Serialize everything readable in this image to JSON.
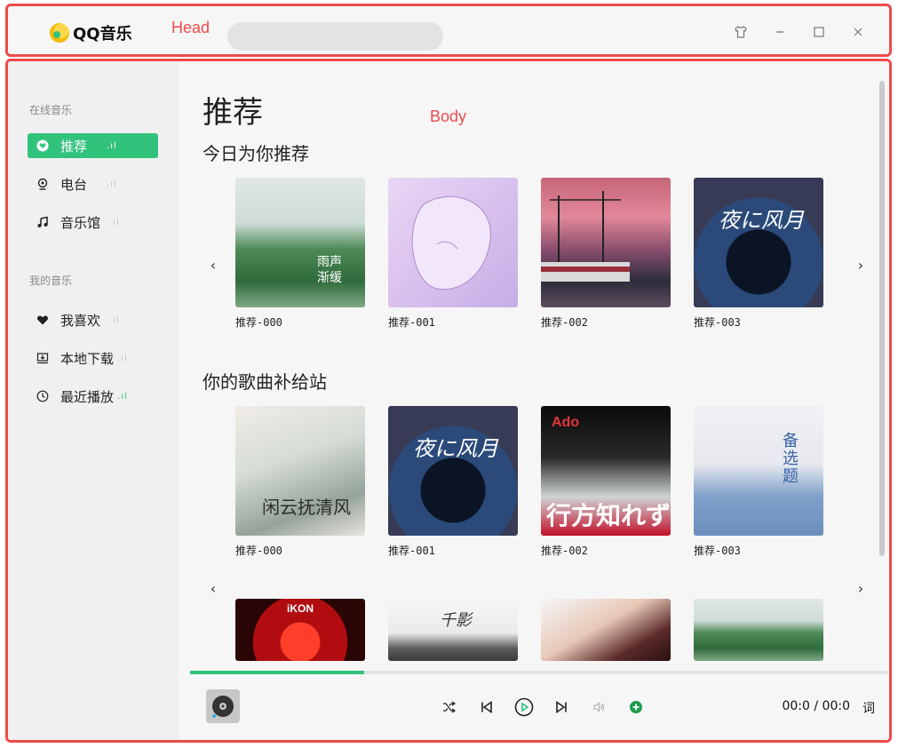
{
  "overlay": {
    "head_tag": "Head",
    "body_tag": "Body"
  },
  "header": {
    "app_name": "QQ音乐",
    "search_placeholder": ""
  },
  "sidebar": {
    "online_title": "在线音乐",
    "mine_title": "我的音乐",
    "items": [
      {
        "label": "推荐",
        "icon": "heart-disc-icon"
      },
      {
        "label": "电台",
        "icon": "radio-icon"
      },
      {
        "label": "音乐馆",
        "icon": "music-note-icon"
      },
      {
        "label": "我喜欢",
        "icon": "heart-icon"
      },
      {
        "label": "本地下载",
        "icon": "download-icon"
      },
      {
        "label": "最近播放",
        "icon": "clock-icon"
      }
    ],
    "bars": ".ıl"
  },
  "main": {
    "page_title": "推荐",
    "section1_title": "今日为你推荐",
    "section2_title": "你的歌曲补给站",
    "row1": [
      {
        "label": "推荐-000"
      },
      {
        "label": "推荐-001"
      },
      {
        "label": "推荐-002"
      },
      {
        "label": "推荐-003"
      }
    ],
    "row2": [
      {
        "label": "推荐-000"
      },
      {
        "label": "推荐-001"
      },
      {
        "label": "推荐-002"
      },
      {
        "label": "推荐-003"
      }
    ],
    "arrows": {
      "prev": "‹",
      "next": "›"
    }
  },
  "player": {
    "time_current": "00:0",
    "time_sep": "/",
    "time_total": "00:0",
    "lyric_label": "词",
    "progress": 0.25
  }
}
